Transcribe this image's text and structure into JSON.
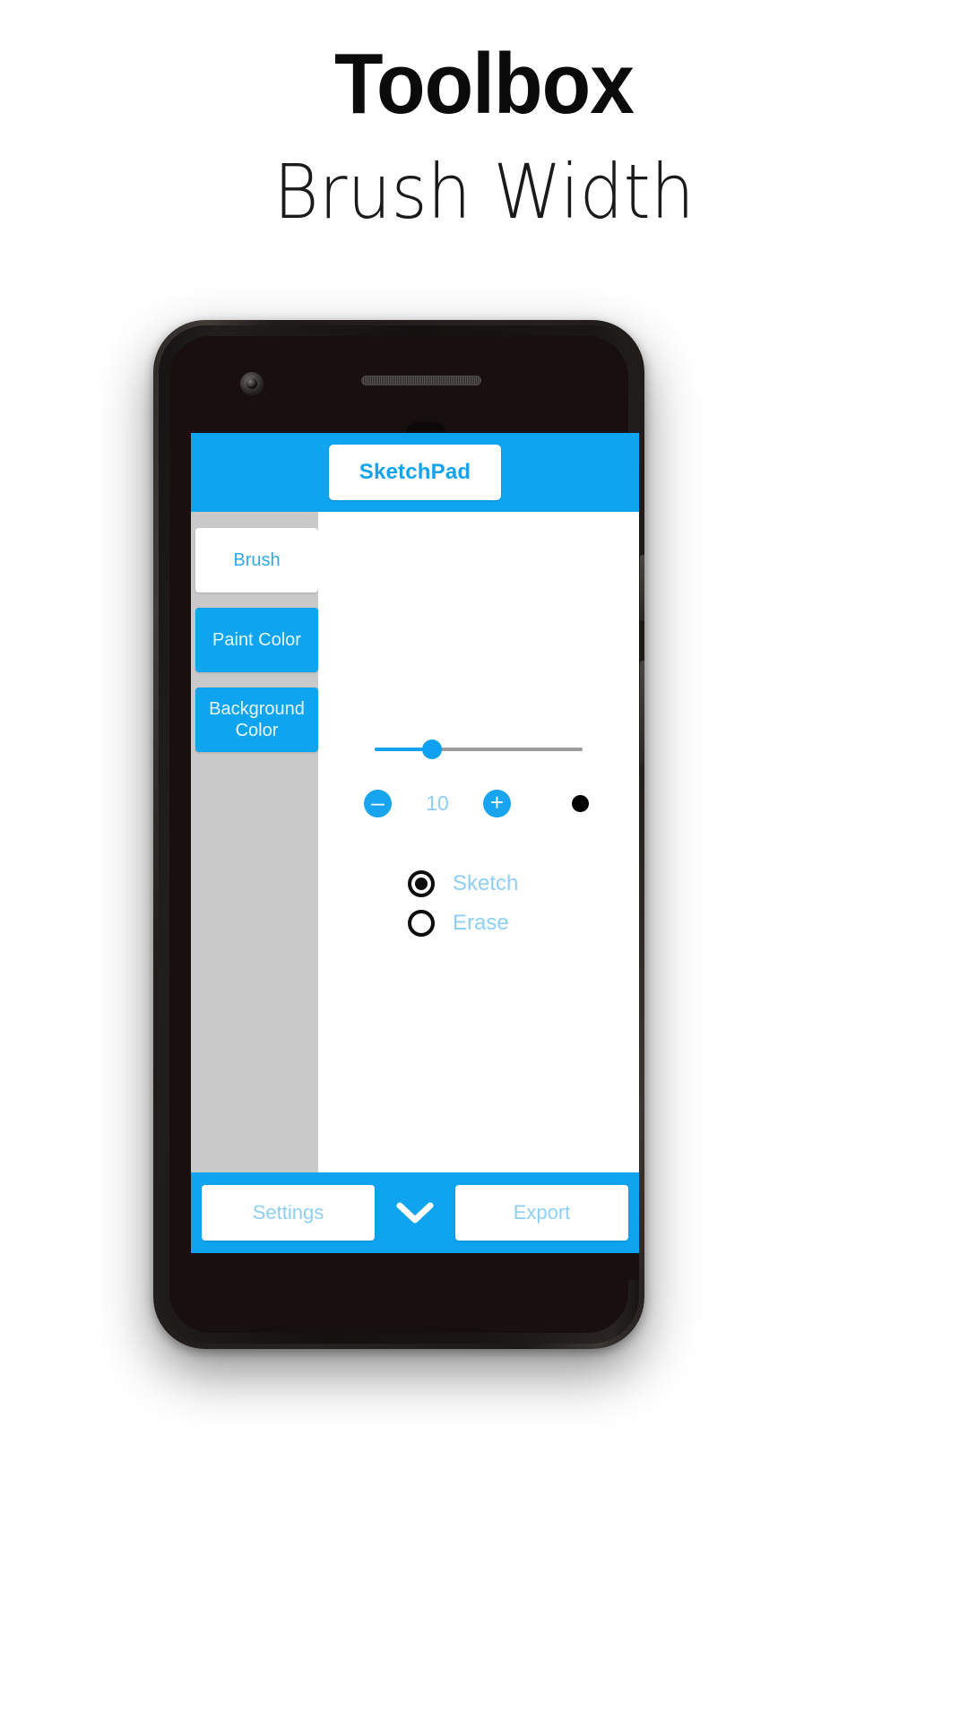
{
  "headline": {
    "title": "Toolbox",
    "subtitle": "Brush Width"
  },
  "app": {
    "appbar": {
      "title": "SketchPad"
    },
    "sidebar": {
      "items": [
        {
          "label": "Brush",
          "state": "active"
        },
        {
          "label": "Paint Color",
          "state": "normal"
        },
        {
          "label": "Background Color",
          "state": "normal"
        }
      ]
    },
    "brush": {
      "slider": {
        "value": 10,
        "min": 1,
        "max": 50,
        "fill_percent": 28
      },
      "decrement_label": "–",
      "increment_label": "+",
      "value_text": "10",
      "preview_dot": "brush-preview-dot"
    },
    "modes": [
      {
        "label": "Sketch",
        "selected": true
      },
      {
        "label": "Erase",
        "selected": false
      }
    ],
    "bottombar": {
      "settings_label": "Settings",
      "expand_icon": "chevron-down-icon",
      "export_label": "Export"
    }
  },
  "colors": {
    "accent": "#0fa4ef",
    "accent_text": "#13a3ef",
    "muted_label": "#8ecff5",
    "sidebar_bg": "#c9c9c9",
    "track_inactive": "#9a9a9a",
    "radio_stroke": "#0d0d0d"
  }
}
